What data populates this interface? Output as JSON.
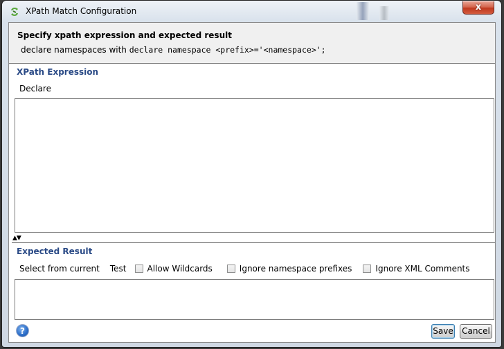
{
  "window": {
    "title": "XPath Match Configuration",
    "close_label": "x"
  },
  "header": {
    "title": "Specify xpath expression and expected result",
    "desc_prefix": "declare namespaces with ",
    "desc_code": "declare namespace <prefix>='<namespace>';"
  },
  "xpath_section": {
    "label": "XPath Expression",
    "declare_label": "Declare",
    "expression_value": ""
  },
  "splitter": {
    "up_arrow": "▲",
    "down_arrow": "▼"
  },
  "result_section": {
    "label": "Expected Result",
    "select_from_current_label": "Select from current",
    "test_label": "Test",
    "checkboxes": [
      {
        "label": "Allow Wildcards",
        "checked": false
      },
      {
        "label": "Ignore namespace prefixes",
        "checked": false
      },
      {
        "label": "Ignore XML Comments",
        "checked": false
      }
    ],
    "expected_value": ""
  },
  "footer": {
    "help_glyph": "?",
    "save_label": "Save",
    "cancel_label": "Cancel"
  }
}
